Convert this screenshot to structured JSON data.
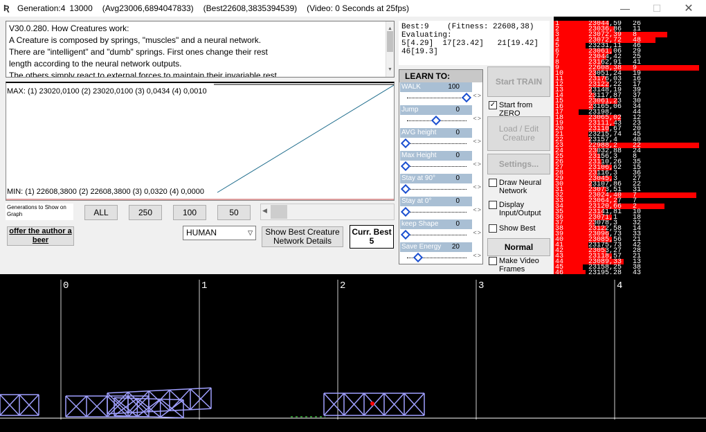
{
  "titlebar": {
    "generation": "Generation:4",
    "count": "13000",
    "avg": "(Avg23006,6894047833)",
    "best": "(Best22608,3835394539)",
    "video": "(Video: 0 Seconds at 25fps)"
  },
  "info_text": "V30.0.280. How Creatures work:\nA Creature is composed by springs, \"muscles\" and a neural network.\nThere are \"intelligent\" and \"dumb\" springs. First ones change their rest\nlength according to the neural network outputs.\nThe others simply react to external forces to maintain their invariable rest",
  "graph": {
    "max_label": "MAX: (1) 23020,0100      (2) 23020,0100  (3) 0,0434        (4) 0,0010",
    "min_label": "MIN: (1) 22608,3800      (2) 22608,3800  (3) 0,0320        (4) 0,0000"
  },
  "gen_controls": {
    "label": "Generations to Show on Graph",
    "all": "ALL",
    "b250": "250",
    "b100": "100",
    "b50": "50"
  },
  "buttons": {
    "offer_beer": "offer the author a beer",
    "species": "HUMAN",
    "show_best": "Show Best Creature Network Details",
    "curr_best": "Curr. Best",
    "curr_best_value": "5",
    "start_train": "Start TRAIN",
    "load_edit": "Load / Edit Creature",
    "settings": "Settings...",
    "normal": "Normal"
  },
  "best_box": {
    "line1": "Best:9    (Fitness: 22608,38)",
    "line2": "Evaluating:",
    "line3": "5[4.29]  17[23.42]   21[19.42]",
    "line4": "46[19.3]"
  },
  "learn": {
    "header": "LEARN TO:",
    "items": [
      {
        "label": "WALK",
        "value": "100",
        "frac": 1.0
      },
      {
        "label": "Jump",
        "value": "0",
        "frac": 0.5
      },
      {
        "label": "AVG height",
        "value": "0",
        "frac": 0.0
      },
      {
        "label": "Max Height",
        "value": "0",
        "frac": 0.0
      },
      {
        "label": "Stay at 90°",
        "value": "0",
        "frac": 0.0
      },
      {
        "label": "Stay at 0°",
        "value": "0",
        "frac": 0.0
      },
      {
        "label": "keep Shape",
        "value": "0",
        "frac": 0.0
      },
      {
        "label": "Save Energy",
        "value": "20",
        "frac": 0.2
      }
    ]
  },
  "checkboxes": {
    "start_zero": "Start from ZERO",
    "draw_nn": "Draw Neural Network",
    "display_io": "Display Input/Output",
    "show_best": "Show Best",
    "make_video": "Make Video Frames"
  },
  "ranking": [
    {
      "id": "1",
      "score": "23044,59",
      "v": "26",
      "frac": 0.38
    },
    {
      "id": "2",
      "score": "23036,86",
      "v": "11",
      "frac": 0.42
    },
    {
      "id": "3",
      "score": "23072,39",
      "v": "8",
      "frac": 0.78
    },
    {
      "id": "4",
      "score": "23072,72",
      "v": "48",
      "frac": 0.7
    },
    {
      "id": "5",
      "score": "23231,11",
      "v": "46",
      "frac": 0.22
    },
    {
      "id": "6",
      "score": "23061,06",
      "v": "29",
      "frac": 0.4
    },
    {
      "id": "7",
      "score": "23044,42",
      "v": "25",
      "frac": 0.36
    },
    {
      "id": "8",
      "score": "23162,91",
      "v": "41",
      "frac": 0.33
    },
    {
      "id": "9",
      "score": "22608,38",
      "v": "9",
      "frac": 1.0
    },
    {
      "id": "10",
      "score": "23051,24",
      "v": "19",
      "frac": 0.29
    },
    {
      "id": "11",
      "score": "23176,03",
      "v": "16",
      "frac": 0.36
    },
    {
      "id": "12",
      "score": "23122,22",
      "v": "17",
      "frac": 0.38
    },
    {
      "id": "13",
      "score": "23148,19",
      "v": "39",
      "frac": 0.26
    },
    {
      "id": "14",
      "score": "23117,87",
      "v": "37",
      "frac": 0.28
    },
    {
      "id": "15",
      "score": "23061,23",
      "v": "30",
      "frac": 0.44
    },
    {
      "id": "16",
      "score": "23165,06",
      "v": "34",
      "frac": 0.27
    },
    {
      "id": "17",
      "score": "23198,",
      "v": "44",
      "frac": 0.17
    },
    {
      "id": "18",
      "score": "23065,02",
      "v": "12",
      "frac": 0.46
    },
    {
      "id": "19",
      "score": "23111,43",
      "v": "23",
      "frac": 0.42
    },
    {
      "id": "20",
      "score": "23110,67",
      "v": "20",
      "frac": 0.38
    },
    {
      "id": "21",
      "score": "23215,74",
      "v": "45",
      "frac": 0.24
    },
    {
      "id": "22",
      "score": "23157,4",
      "v": "40",
      "frac": 0.25
    },
    {
      "id": "23",
      "score": "22988,2",
      "v": "22",
      "frac": 1.0
    },
    {
      "id": "24",
      "score": "23032,88",
      "v": "24",
      "frac": 0.3
    },
    {
      "id": "25",
      "score": "23156,3",
      "v": "8",
      "frac": 0.32
    },
    {
      "id": "26",
      "score": "23110,26",
      "v": "35",
      "frac": 0.33
    },
    {
      "id": "27",
      "score": "23106,62",
      "v": "15",
      "frac": 0.4
    },
    {
      "id": "28",
      "score": "23116,3",
      "v": "36",
      "frac": 0.3
    },
    {
      "id": "29",
      "score": "23045,3",
      "v": "27",
      "frac": 0.4
    },
    {
      "id": "30",
      "score": "23107,86",
      "v": "22",
      "frac": 0.26
    },
    {
      "id": "31",
      "score": "23073,51",
      "v": "31",
      "frac": 0.36
    },
    {
      "id": "32",
      "score": "23024,40",
      "v": "7",
      "frac": 0.98
    },
    {
      "id": "33",
      "score": "23064,27",
      "v": "7",
      "frac": 0.44
    },
    {
      "id": "34",
      "score": "23120,66",
      "v": "2",
      "frac": 0.76
    },
    {
      "id": "35",
      "score": "23141,81",
      "v": "10",
      "frac": 0.34
    },
    {
      "id": "36",
      "score": "23071,1",
      "v": "18",
      "frac": 0.4
    },
    {
      "id": "37",
      "score": "23078,3",
      "v": "32",
      "frac": 0.28
    },
    {
      "id": "38",
      "score": "23122,58",
      "v": "14",
      "frac": 0.36
    },
    {
      "id": "39",
      "score": "23096,73",
      "v": "33",
      "frac": 0.38
    },
    {
      "id": "40",
      "score": "23085,56",
      "v": "21",
      "frac": 0.4
    },
    {
      "id": "41",
      "score": "23175,73",
      "v": "42",
      "frac": 0.24
    },
    {
      "id": "42",
      "score": "23053,27",
      "v": "28",
      "frac": 0.36
    },
    {
      "id": "43",
      "score": "23118,57",
      "v": "21",
      "frac": 0.4
    },
    {
      "id": "44",
      "score": "23089,33",
      "v": "13",
      "frac": 0.48
    },
    {
      "id": "45",
      "score": "23158,25",
      "v": "38",
      "frac": 0.2
    },
    {
      "id": "46",
      "score": "23195,28",
      "v": "43",
      "frac": 0.22
    }
  ],
  "sim_markers": [
    "0",
    "1",
    "2",
    "3",
    "4"
  ],
  "colors": {
    "bar": "#ff0000",
    "slider_label": "#a9bfd4",
    "creature": "#a0a0ff"
  }
}
